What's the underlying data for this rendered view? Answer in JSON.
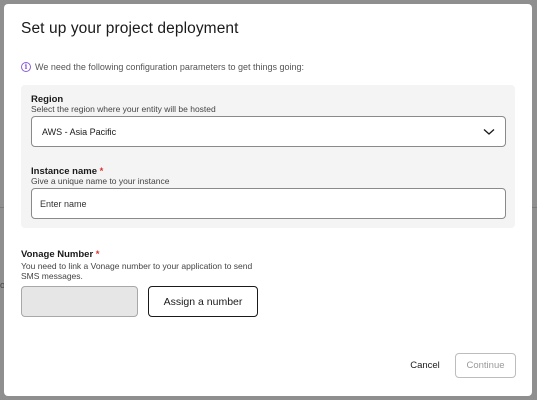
{
  "modal": {
    "title": "Set up your project deployment",
    "info_text": "We need the following configuration parameters to get things going:",
    "info_icon": "info-icon"
  },
  "region": {
    "label": "Region",
    "help": "Select the region where your entity will be hosted",
    "selected": "AWS - Asia Pacific"
  },
  "instance": {
    "label": "Instance name",
    "required_marker": "*",
    "help": "Give a unique name to your instance",
    "placeholder": "Enter name",
    "value": ""
  },
  "vonage": {
    "label": "Vonage Number",
    "required_marker": "*",
    "help": "You need to link a Vonage number to your application to send SMS messages.",
    "assign_label": "Assign a number"
  },
  "footer": {
    "cancel_label": "Cancel",
    "continue_label": "Continue"
  },
  "colors": {
    "accent": "#8a5ed6",
    "required": "#e03131",
    "panel_bg": "#f4f4f4",
    "overlay": "#8f8f8f"
  }
}
